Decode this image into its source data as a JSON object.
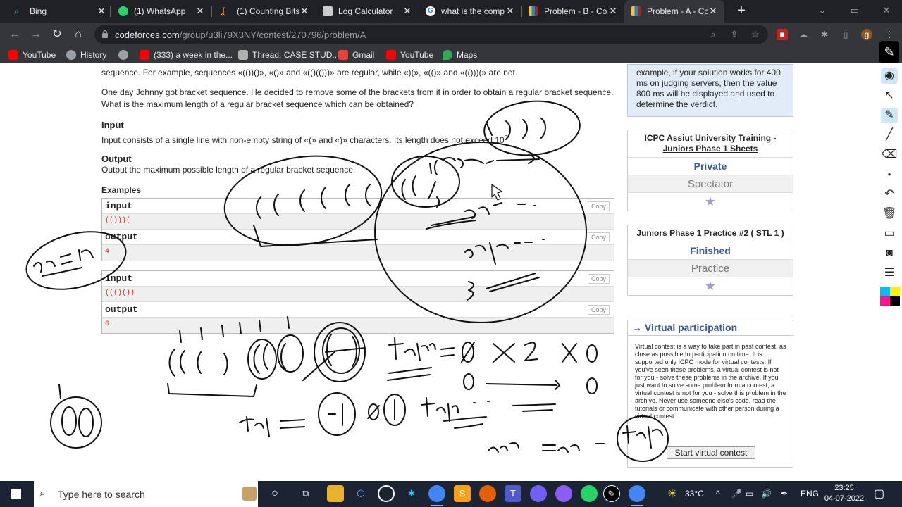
{
  "browser": {
    "tabs": [
      {
        "label": "Bing",
        "icon": "search-icon",
        "color": "#4da3ff"
      },
      {
        "label": "(1) WhatsApp",
        "icon": "whatsapp-icon",
        "color": "#25d366"
      },
      {
        "label": "(1) Counting Bits",
        "icon": "leetcode-icon",
        "color": "#f89f1b"
      },
      {
        "label": "Log Calculator",
        "icon": "calculator-icon",
        "color": "#cccccc"
      },
      {
        "label": "what is the comp",
        "icon": "google-icon",
        "color": "#4285f4"
      },
      {
        "label": "Problem - B - Co",
        "icon": "codeforces-icon",
        "color": "#1f8acb"
      },
      {
        "label": "Problem - A - Co",
        "icon": "codeforces-icon",
        "color": "#1f8acb"
      }
    ],
    "url_host": "codeforces.com",
    "url_path": "/group/u3li79X3NY/contest/270796/problem/A",
    "profile_letter": "g",
    "bookmarks": [
      {
        "label": "YouTube",
        "color": "#ff0000"
      },
      {
        "label": "History",
        "color": "#9aa0a6"
      },
      {
        "label": "",
        "color": "#9aa0a6"
      },
      {
        "label": "(333) a week in the...",
        "color": "#ff0000"
      },
      {
        "label": "Thread: CASE STUD...",
        "color": "#b0b0b0"
      },
      {
        "label": "Gmail",
        "color": "#ea4335"
      },
      {
        "label": "YouTube",
        "color": "#ff0000"
      },
      {
        "label": "Maps",
        "color": "#34a853"
      }
    ]
  },
  "problem": {
    "line1": "sequence. For example, sequences «(())()», «()» and «(()(()))» are regular, while «)(», «(()» and «(()))(» are not.",
    "line2": "One day Johnny got bracket sequence. He decided to remove some of the brackets from it in order to obtain a regular bracket sequence.",
    "line3": "What is the maximum length of a regular bracket sequence which can be obtained?",
    "input_title": "Input",
    "input_text": "Input consists of a single line with non-empty string of «(» and «)» characters. Its length does not exceed 10",
    "input_exp": "6",
    "output_title": "Output",
    "output_text": "Output the maximum possible length of a regular bracket sequence.",
    "examples_title": "Examples",
    "examples": [
      {
        "input_label": "input",
        "input": "(()))(",
        "output_label": "output",
        "output": "4"
      },
      {
        "input_label": "input",
        "input": "((()())",
        "output_label": "output",
        "output": "6"
      }
    ],
    "copy_label": "Copy"
  },
  "sidebar": {
    "note": "example, if your solution works for 400 ms on judging servers, then the value 800 ms will be displayed and used to determine the verdict.",
    "group_panel": {
      "title": "ICPC Assiut University Training - Juniors Phase 1 Sheets",
      "status1": "Private",
      "status2": "Spectator"
    },
    "contest_panel": {
      "title": "Juniors Phase 1 Practice #2 ( STL 1 )",
      "status1": "Finished",
      "status2": "Practice"
    },
    "star": "★",
    "virtual": {
      "title": "→ Virtual participation",
      "text": "Virtual contest is a way to take part in past contest, as close as possible to participation on time. It is supported only ICPC mode for virtual contests. If you've seen these problems, a virtual contest is not for you - solve these problems in the archive. If you just want to solve some problem from a contest, a virtual contest is not for you - solve this problem in the archive. Never use someone else's code, read the tutorials or communicate with other person during a virtual contest.",
      "button": "Start virtual contest"
    }
  },
  "taskbar": {
    "search_placeholder": "Type here to search",
    "temperature": "33°C",
    "language": "ENG",
    "time": "23:25",
    "date": "04-07-2022"
  },
  "colors": {
    "tabstrip": "#202124",
    "toolbar": "#35363a",
    "link_blue": "#3b5998",
    "taskbar": "#1c2433",
    "ink": "#111111"
  }
}
